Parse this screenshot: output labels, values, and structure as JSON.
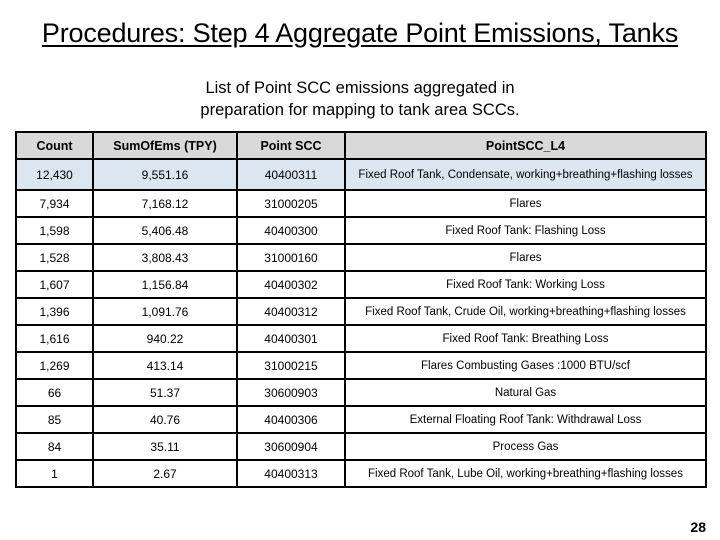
{
  "slide": {
    "title": "Procedures: Step 4 Aggregate Point Emissions, Tanks",
    "subtitle_lines": [
      "List of Point SCC emissions aggregated in",
      "preparation for mapping to tank area SCCs."
    ],
    "page_number": "28"
  },
  "table": {
    "columns": [
      "Count",
      "SumOfEms (TPY)",
      "Point SCC",
      "PointSCC_L4"
    ],
    "highlight_color": "#dce6f1",
    "header_color": "#d9d9d9",
    "rows": [
      {
        "count": "12,430",
        "sum": "9,551.16",
        "scc": "40400311",
        "desc": "Fixed Roof Tank, Condensate, working+breathing+flashing losses"
      },
      {
        "count": "7,934",
        "sum": "7,168.12",
        "scc": "31000205",
        "desc": "Flares"
      },
      {
        "count": "1,598",
        "sum": "5,406.48",
        "scc": "40400300",
        "desc": "Fixed Roof Tank: Flashing Loss"
      },
      {
        "count": "1,528",
        "sum": "3,808.43",
        "scc": "31000160",
        "desc": "Flares"
      },
      {
        "count": "1,607",
        "sum": "1,156.84",
        "scc": "40400302",
        "desc": "Fixed Roof Tank: Working Loss"
      },
      {
        "count": "1,396",
        "sum": "1,091.76",
        "scc": "40400312",
        "desc": "Fixed Roof Tank, Crude Oil, working+breathing+flashing losses"
      },
      {
        "count": "1,616",
        "sum": "940.22",
        "scc": "40400301",
        "desc": "Fixed Roof Tank: Breathing Loss"
      },
      {
        "count": "1,269",
        "sum": "413.14",
        "scc": "31000215",
        "desc": "Flares Combusting Gases :1000 BTU/scf"
      },
      {
        "count": "66",
        "sum": "51.37",
        "scc": "30600903",
        "desc": "Natural Gas"
      },
      {
        "count": "85",
        "sum": "40.76",
        "scc": "40400306",
        "desc": "External Floating Roof Tank: Withdrawal Loss"
      },
      {
        "count": "84",
        "sum": "35.11",
        "scc": "30600904",
        "desc": "Process Gas"
      },
      {
        "count": "1",
        "sum": "2.67",
        "scc": "40400313",
        "desc": "Fixed Roof Tank, Lube Oil, working+breathing+flashing losses"
      }
    ]
  }
}
